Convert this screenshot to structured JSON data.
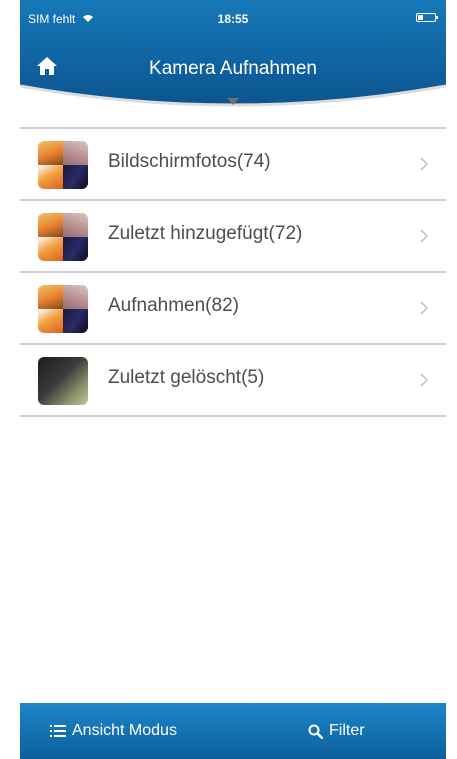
{
  "status_bar": {
    "carrier": "SIM fehlt",
    "time": "18:55"
  },
  "header": {
    "title": "Kamera Aufnahmen",
    "home_icon": "home-icon",
    "menu_icon": "chevron-down-icon"
  },
  "albums": [
    {
      "label": "Bildschirmfotos(74)",
      "thumb": "mixed"
    },
    {
      "label": "Zuletzt hinzugefügt(72)",
      "thumb": "mixed"
    },
    {
      "label": "Aufnahmen(82)",
      "thumb": "mixed"
    },
    {
      "label": "Zuletzt gelöscht(5)",
      "thumb": "single"
    }
  ],
  "toolbar": {
    "view_mode_label": "Ansicht Modus",
    "filter_label": "Filter"
  },
  "colors": {
    "header_blue": "#0e5f9c",
    "toolbar_blue": "#1279b8",
    "divider": "#cfcfcf",
    "text": "#4d4d4d"
  }
}
